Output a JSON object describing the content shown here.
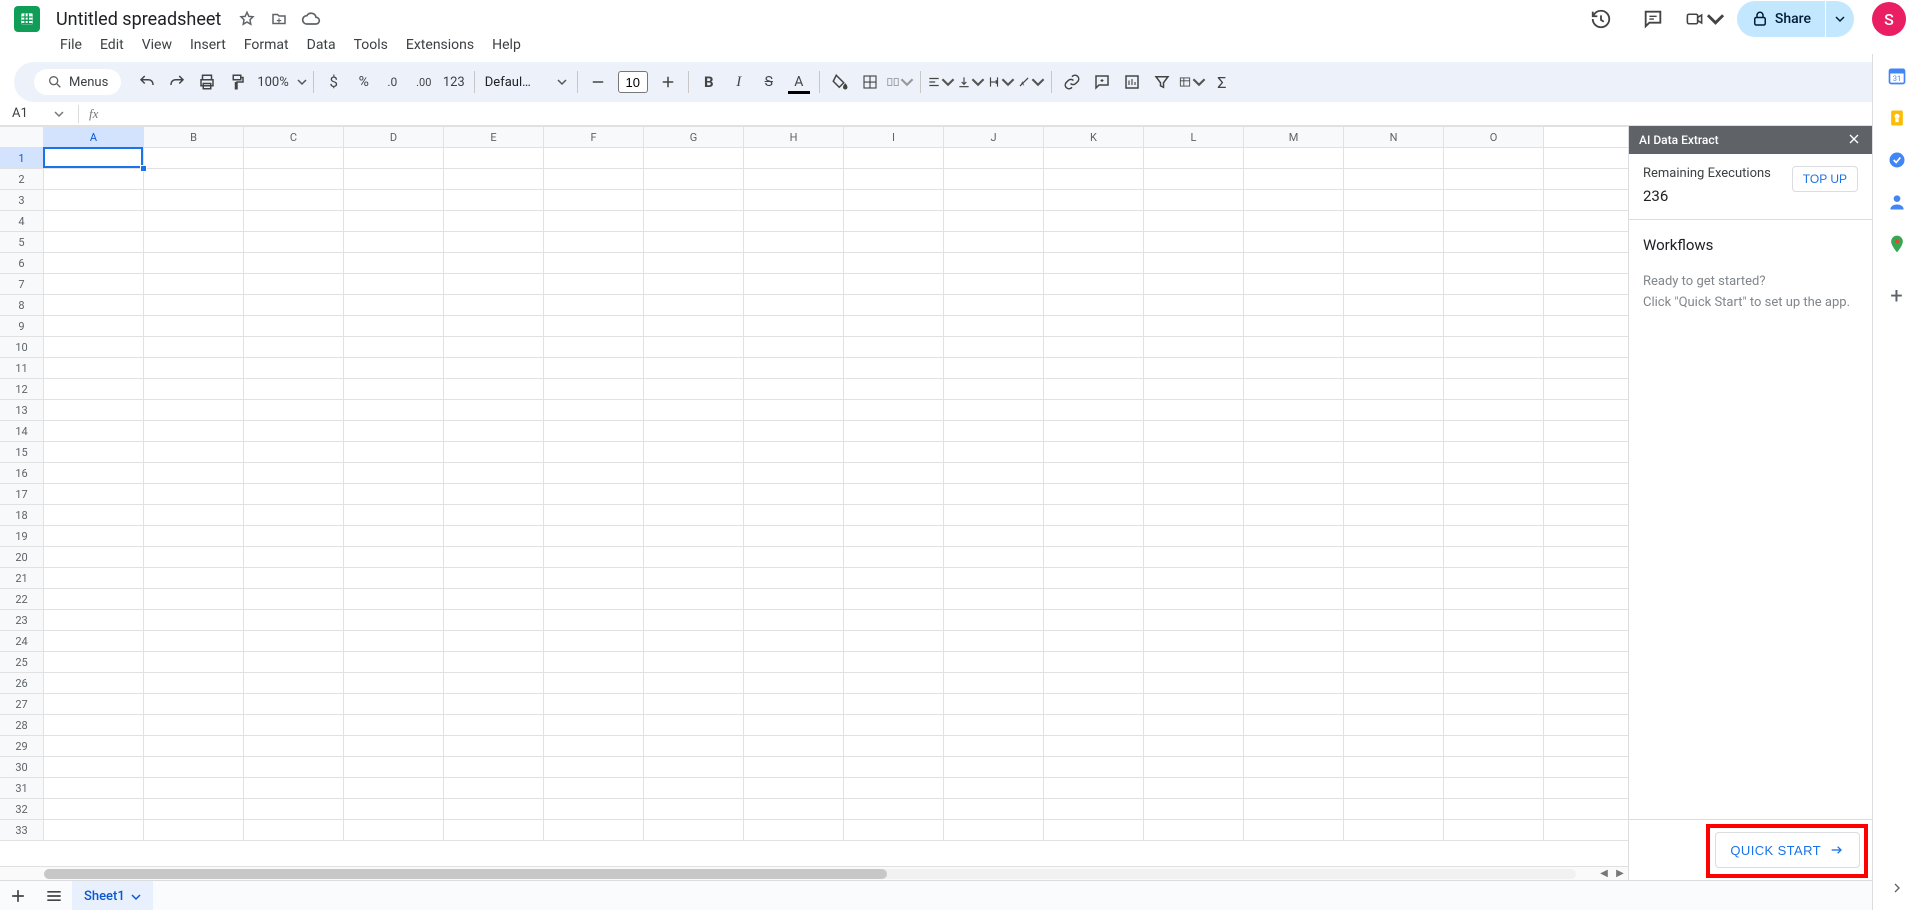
{
  "doc": {
    "title": "Untitled spreadsheet"
  },
  "menus": [
    "File",
    "Edit",
    "View",
    "Insert",
    "Format",
    "Data",
    "Tools",
    "Extensions",
    "Help"
  ],
  "toolbar": {
    "search_placeholder": "Menus",
    "zoom": "100%",
    "font": "Defaul…",
    "font_size": "10",
    "number_format": "123"
  },
  "share_label": "Share",
  "avatar_letter": "S",
  "name_box": "A1",
  "columns": [
    "A",
    "B",
    "C",
    "D",
    "E",
    "F",
    "G",
    "H",
    "I",
    "J",
    "K",
    "L",
    "M",
    "N",
    "O"
  ],
  "row_count": 33,
  "selected": {
    "row": 1,
    "col": "A"
  },
  "panel": {
    "title": "AI Data Extract",
    "remaining_label": "Remaining Executions",
    "remaining_value": "236",
    "topup": "TOP UP",
    "workflows": "Workflows",
    "hint1": "Ready to get started?",
    "hint2": "Click \"Quick Start\" to set up the app.",
    "quick": "QUICK START"
  },
  "sheet_tab": "Sheet1"
}
